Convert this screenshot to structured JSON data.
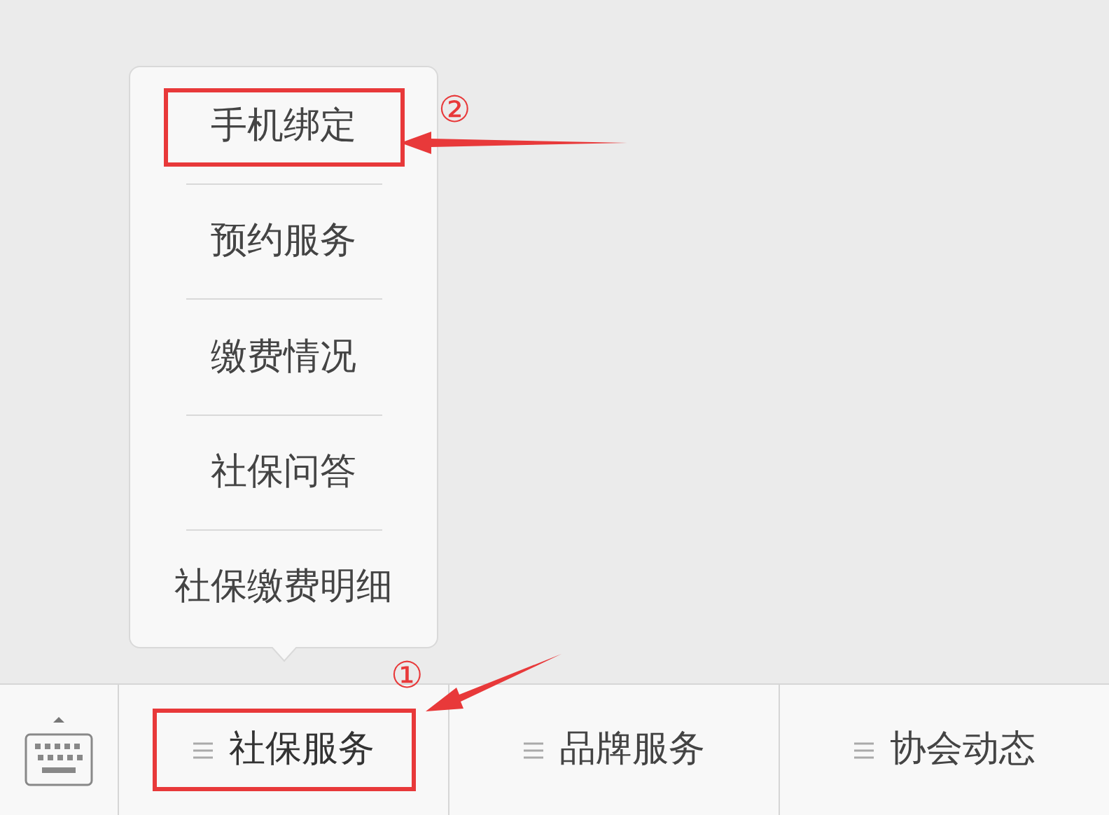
{
  "popup_menu": {
    "items": [
      {
        "label": "手机绑定",
        "annotated": true
      },
      {
        "label": "预约服务",
        "annotated": false
      },
      {
        "label": "缴费情况",
        "annotated": false
      },
      {
        "label": "社保问答",
        "annotated": false
      },
      {
        "label": "社保缴费明细",
        "annotated": false
      }
    ]
  },
  "menu_bar": {
    "tabs": [
      {
        "label": "社保服务",
        "selected": true,
        "annotated": true
      },
      {
        "label": "品牌服务",
        "selected": false,
        "annotated": false
      },
      {
        "label": "协会动态",
        "selected": false,
        "annotated": false
      }
    ]
  },
  "annotations": [
    {
      "label": "②"
    },
    {
      "label": "①"
    }
  ]
}
